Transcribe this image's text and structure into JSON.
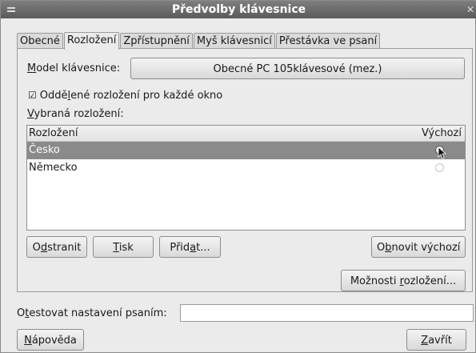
{
  "window": {
    "title": "Předvolby klávesnice"
  },
  "tabs": [
    {
      "label": "Obecné"
    },
    {
      "label": "Rozložení"
    },
    {
      "label": "Zpřístupnění"
    },
    {
      "label": "Myš klávesnicí"
    },
    {
      "label": "Přestávka ve psaní"
    }
  ],
  "active_tab": "Rozložení",
  "model": {
    "label": "Model klávesnice:",
    "value": "Obecné PC 105klávesové (mez.)"
  },
  "separate_layout": {
    "label": "Oddělené rozložení pro každé okno",
    "checked": true
  },
  "selected_layouts_label": "Vybraná rozložení:",
  "layout_table": {
    "headers": [
      "Rozložení",
      "Výchozí"
    ],
    "rows": [
      {
        "name": "Česko",
        "default": true,
        "selected": true
      },
      {
        "name": "Německo",
        "default": false,
        "selected": false
      }
    ]
  },
  "buttons": {
    "remove": "Odstranit",
    "print": "Tisk",
    "add": "Přidat...",
    "reset": "Obnovit výchozí",
    "options": "Možnosti rozložení...",
    "help": "Nápověda",
    "close": "Zavřít"
  },
  "test_field": {
    "label": "Otestovat nastavení psaním:",
    "value": ""
  }
}
